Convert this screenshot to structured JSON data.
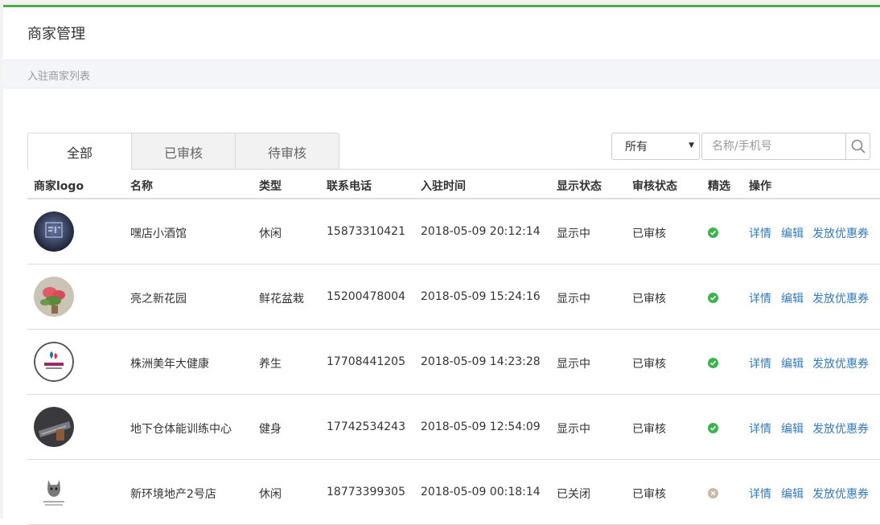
{
  "page": {
    "title": "商家管理",
    "subtitle": "入驻商家列表"
  },
  "tabs": [
    {
      "label": "全部",
      "active": true
    },
    {
      "label": "已审核",
      "active": false
    },
    {
      "label": "待审核",
      "active": false
    }
  ],
  "filter": {
    "selected": "所有"
  },
  "search": {
    "placeholder": "名称/手机号"
  },
  "table": {
    "headers": [
      "商家logo",
      "名称",
      "类型",
      "联系电话",
      "入驻时间",
      "显示状态",
      "审核状态",
      "精选",
      "操作"
    ],
    "rows": [
      {
        "name": "嘿店小酒馆",
        "type": "休闲",
        "phone": "15873310421",
        "time": "2018-05-09 20:12:14",
        "display": "显示中",
        "audit": "已审核",
        "featured": true,
        "logo": "bar-logo"
      },
      {
        "name": "亮之新花园",
        "type": "鲜花盆栽",
        "phone": "15200478004",
        "time": "2018-05-09 15:24:16",
        "display": "显示中",
        "audit": "已审核",
        "featured": true,
        "logo": "flower-logo"
      },
      {
        "name": "株洲美年大健康",
        "type": "养生",
        "phone": "17708441205",
        "time": "2018-05-09 14:23:28",
        "display": "显示中",
        "audit": "已审核",
        "featured": true,
        "logo": "health-logo"
      },
      {
        "name": "地下仓体能训练中心",
        "type": "健身",
        "phone": "17742534243",
        "time": "2018-05-09 12:54:09",
        "display": "显示中",
        "audit": "已审核",
        "featured": true,
        "logo": "gym-logo"
      },
      {
        "name": "新环境地产2号店",
        "type": "休闲",
        "phone": "18773399305",
        "time": "2018-05-09 00:18:14",
        "display": "已关闭",
        "audit": "已审核",
        "featured": false,
        "logo": "cat-logo"
      }
    ],
    "actions": {
      "detail": "详情",
      "edit": "编辑",
      "coupon": "发放优惠券"
    }
  },
  "colors": {
    "accent_green": "#4cae4c",
    "link": "#337ab7",
    "featured_on": "#3cb34c",
    "featured_off": "#c8b9a8"
  }
}
